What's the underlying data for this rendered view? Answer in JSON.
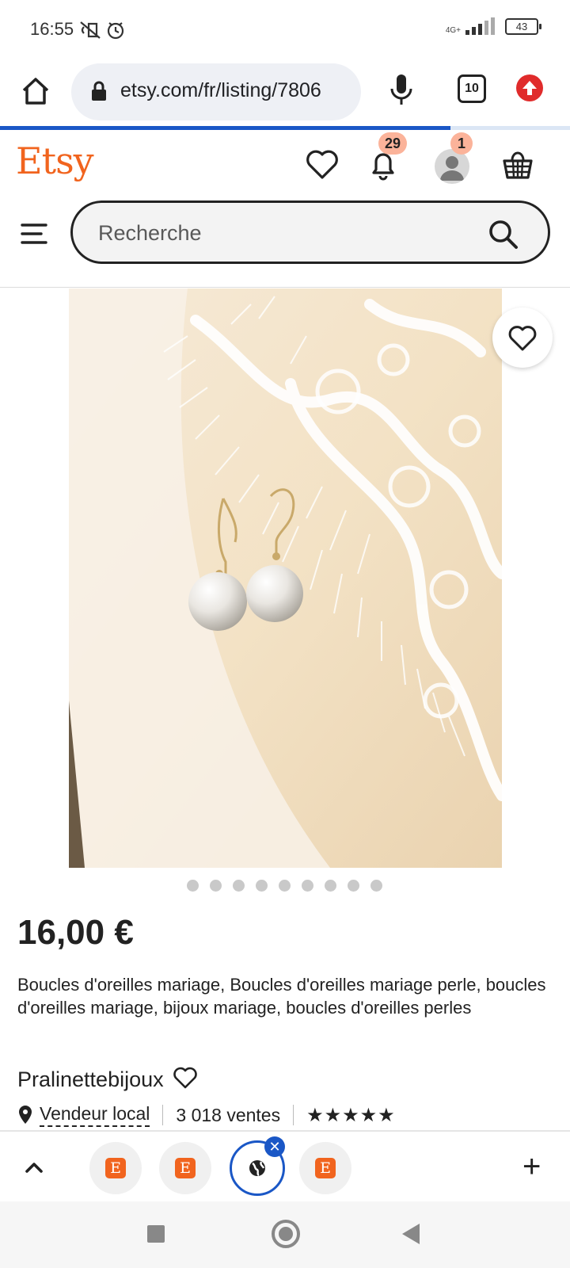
{
  "status_bar": {
    "time": "16:55",
    "network": "4G+",
    "battery": "43"
  },
  "browser": {
    "url": "etsy.com/fr/listing/7806",
    "tab_count": "10",
    "load_progress": 0.79
  },
  "header": {
    "logo": "Etsy",
    "notifications_badge": "29",
    "account_badge": "1"
  },
  "search": {
    "placeholder": "Recherche"
  },
  "listing": {
    "image_count": 9,
    "active_image": 1,
    "price": "16,00 €",
    "title": "Boucles d'oreilles mariage, Boucles d'oreilles mariage perle, boucles d'oreilles mariage, bijoux mariage, boucles d'oreilles perles",
    "shop_name": "Pralinettebijoux",
    "local_label": "Vendeur local",
    "sales": "3 018 ventes",
    "rating": 5
  },
  "tabs": {
    "thumb_letter": "E"
  },
  "colors": {
    "etsy_orange": "#f1641e",
    "chrome_blue": "#1a57c6",
    "badge": "#fbb39a"
  }
}
